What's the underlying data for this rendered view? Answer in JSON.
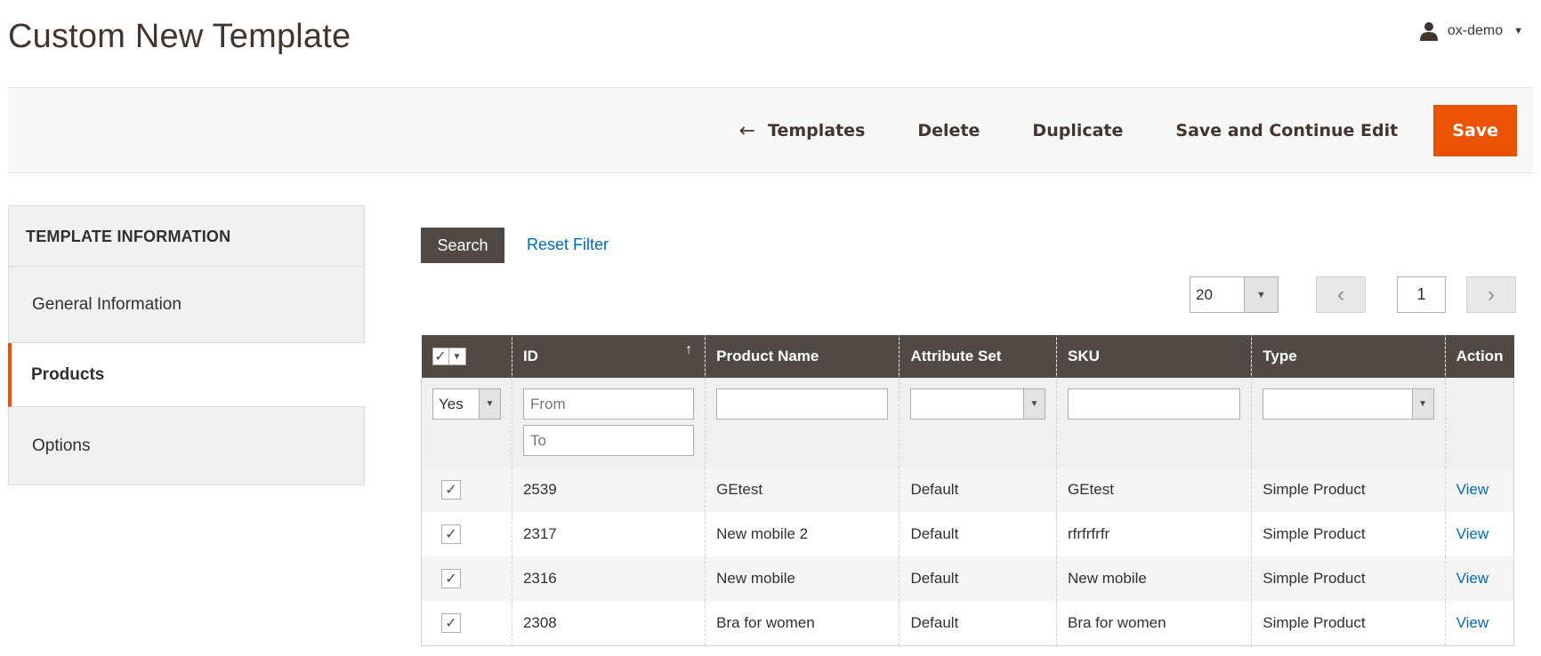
{
  "page": {
    "title": "Custom New Template"
  },
  "user": {
    "name": "ox-demo"
  },
  "actions": {
    "back_label": "Templates",
    "delete_label": "Delete",
    "duplicate_label": "Duplicate",
    "save_continue_label": "Save and Continue Edit",
    "save_label": "Save"
  },
  "sidebar": {
    "header": "TEMPLATE INFORMATION",
    "items": [
      {
        "label": "General Information",
        "active": false
      },
      {
        "label": "Products",
        "active": true
      },
      {
        "label": "Options",
        "active": false
      }
    ]
  },
  "grid_controls": {
    "search_label": "Search",
    "reset_label": "Reset Filter",
    "per_page": "20",
    "current_page": "1"
  },
  "grid": {
    "columns": [
      "ID",
      "Product Name",
      "Attribute Set",
      "SKU",
      "Type",
      "Action"
    ],
    "filters": {
      "select_value": "Yes",
      "id_from_placeholder": "From",
      "id_to_placeholder": "To"
    },
    "rows": [
      {
        "id": "2539",
        "name": "GEtest",
        "attribute_set": "Default",
        "sku": "GEtest",
        "type": "Simple Product",
        "action": "View"
      },
      {
        "id": "2317",
        "name": "New mobile 2",
        "attribute_set": "Default",
        "sku": "rfrfrfrfr",
        "type": "Simple Product",
        "action": "View"
      },
      {
        "id": "2316",
        "name": "New mobile",
        "attribute_set": "Default",
        "sku": "New mobile",
        "type": "Simple Product",
        "action": "View"
      },
      {
        "id": "2308",
        "name": "Bra for women",
        "attribute_set": "Default",
        "sku": "Bra for women",
        "type": "Simple Product",
        "action": "View"
      }
    ]
  },
  "colors": {
    "accent": "#eb5202",
    "header_bg": "#514943",
    "link": "#006bb4"
  }
}
